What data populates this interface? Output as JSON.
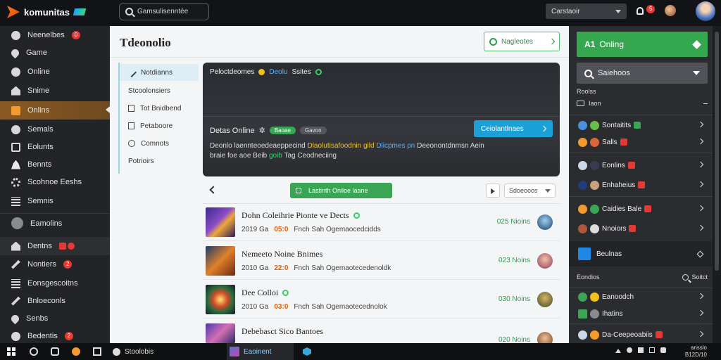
{
  "topbar": {
    "app_name": "komunitas",
    "search_text": "Gamsulisenntée",
    "selector_value": "Carstaoir",
    "bell_badge": "5"
  },
  "sidebar": {
    "items": [
      {
        "label": "Neenelbes",
        "badge": "0"
      },
      {
        "label": "Game"
      },
      {
        "label": "Online"
      },
      {
        "label": "Snime"
      },
      {
        "label": "Onlins"
      },
      {
        "label": "Semals"
      },
      {
        "label": "Eolunts"
      },
      {
        "label": "Bennts"
      },
      {
        "label": "Scohnoe Eeshs"
      },
      {
        "label": "Semnis"
      },
      {
        "label": "Eamolins"
      },
      {
        "label": "Dentns"
      },
      {
        "label": "Nontiers",
        "badge": "2"
      },
      {
        "label": "Eonsgescoitns"
      },
      {
        "label": "Bnloeconls"
      },
      {
        "label": "Senbs"
      },
      {
        "label": "Bedentis",
        "badge": "2"
      }
    ]
  },
  "main": {
    "title": "Tdeonolio",
    "notif_button": "Nagleotes",
    "subnav": [
      "Notdianns",
      "Stcoolonsiers",
      "Tot Bnidbend",
      "Petaboore",
      "Comnots",
      "Potrioirs"
    ],
    "banner": {
      "top_text": "Peloctdeomes",
      "top_link": "Deolu",
      "top_suffix": "Ssites",
      "live_label": "Detas Online",
      "live_star": "✲",
      "pill_green": "Baoae",
      "pill_grey": "Gavon",
      "cta_label": "Ceiolantlnaes",
      "desc_1": "Deonlo laennteoedeaeppecind",
      "desc_y": "Dlaolutisafoodnin gild",
      "desc_b": "Dlicpmes pn",
      "desc_2": "Deeonontdnmsn Aein",
      "desc_3": "braie foe aoe Beib",
      "desc_g": "goib",
      "desc_4": "Tag Ceodneciing"
    },
    "toolbar": {
      "green_button": "Lastinth Oniloe laane",
      "select_label": "Sdoeooos"
    },
    "rows": [
      {
        "title": "Dohn Coleihrie Pionte ve Dects",
        "meta_1": "2019 Ga",
        "meta_2": "05:0",
        "meta_3": "Fnch Sah Ogemaocedcidds",
        "count": "025 Nioins"
      },
      {
        "title": "Nemeeto Noine Bnimes",
        "meta_1": "2010 Ga",
        "meta_2": "22:0",
        "meta_3": "Fnch Sah Ogemaotecedenoldk",
        "count": "023 Noins"
      },
      {
        "title": "Dee Colloi",
        "meta_1": "2010 Ga",
        "meta_2": "03:0",
        "meta_3": "Fnch Sah Ogemaotecednolok",
        "count": "030 Noins"
      },
      {
        "title": "Debebasct Sico Bantoes",
        "meta_1": "",
        "meta_2": "",
        "meta_3": "",
        "count": "020 Noins"
      }
    ]
  },
  "right_panel": {
    "online_button_icon": "A1",
    "online_button_label": "Onling",
    "search_label": "Saiehoos",
    "section_label": "Roolss",
    "filter_label": "Iaon",
    "group_a": [
      "Sontaitits",
      "Salls"
    ],
    "group_b": [
      "Eonlins",
      "Enhaheius"
    ],
    "group_c": [
      "Caidies Bale",
      "Nnoiors"
    ],
    "block_label": "Beulnas",
    "foot_left": "Eondios",
    "foot_right": "Soitct",
    "group_d": [
      "Eanoodch",
      "Ihatins"
    ],
    "last_item": "Da-Ceepeoabiis"
  },
  "taskbar": {
    "app1": "Stoolobis",
    "app2": "Eaoinent",
    "time": "ansslo",
    "date": "B12D/10"
  },
  "colors": {
    "accent_green": "#35a84f",
    "accent_blue": "#1ba0d8",
    "active_sidebar": "#8a5a22",
    "badge_red": "#e53935"
  }
}
